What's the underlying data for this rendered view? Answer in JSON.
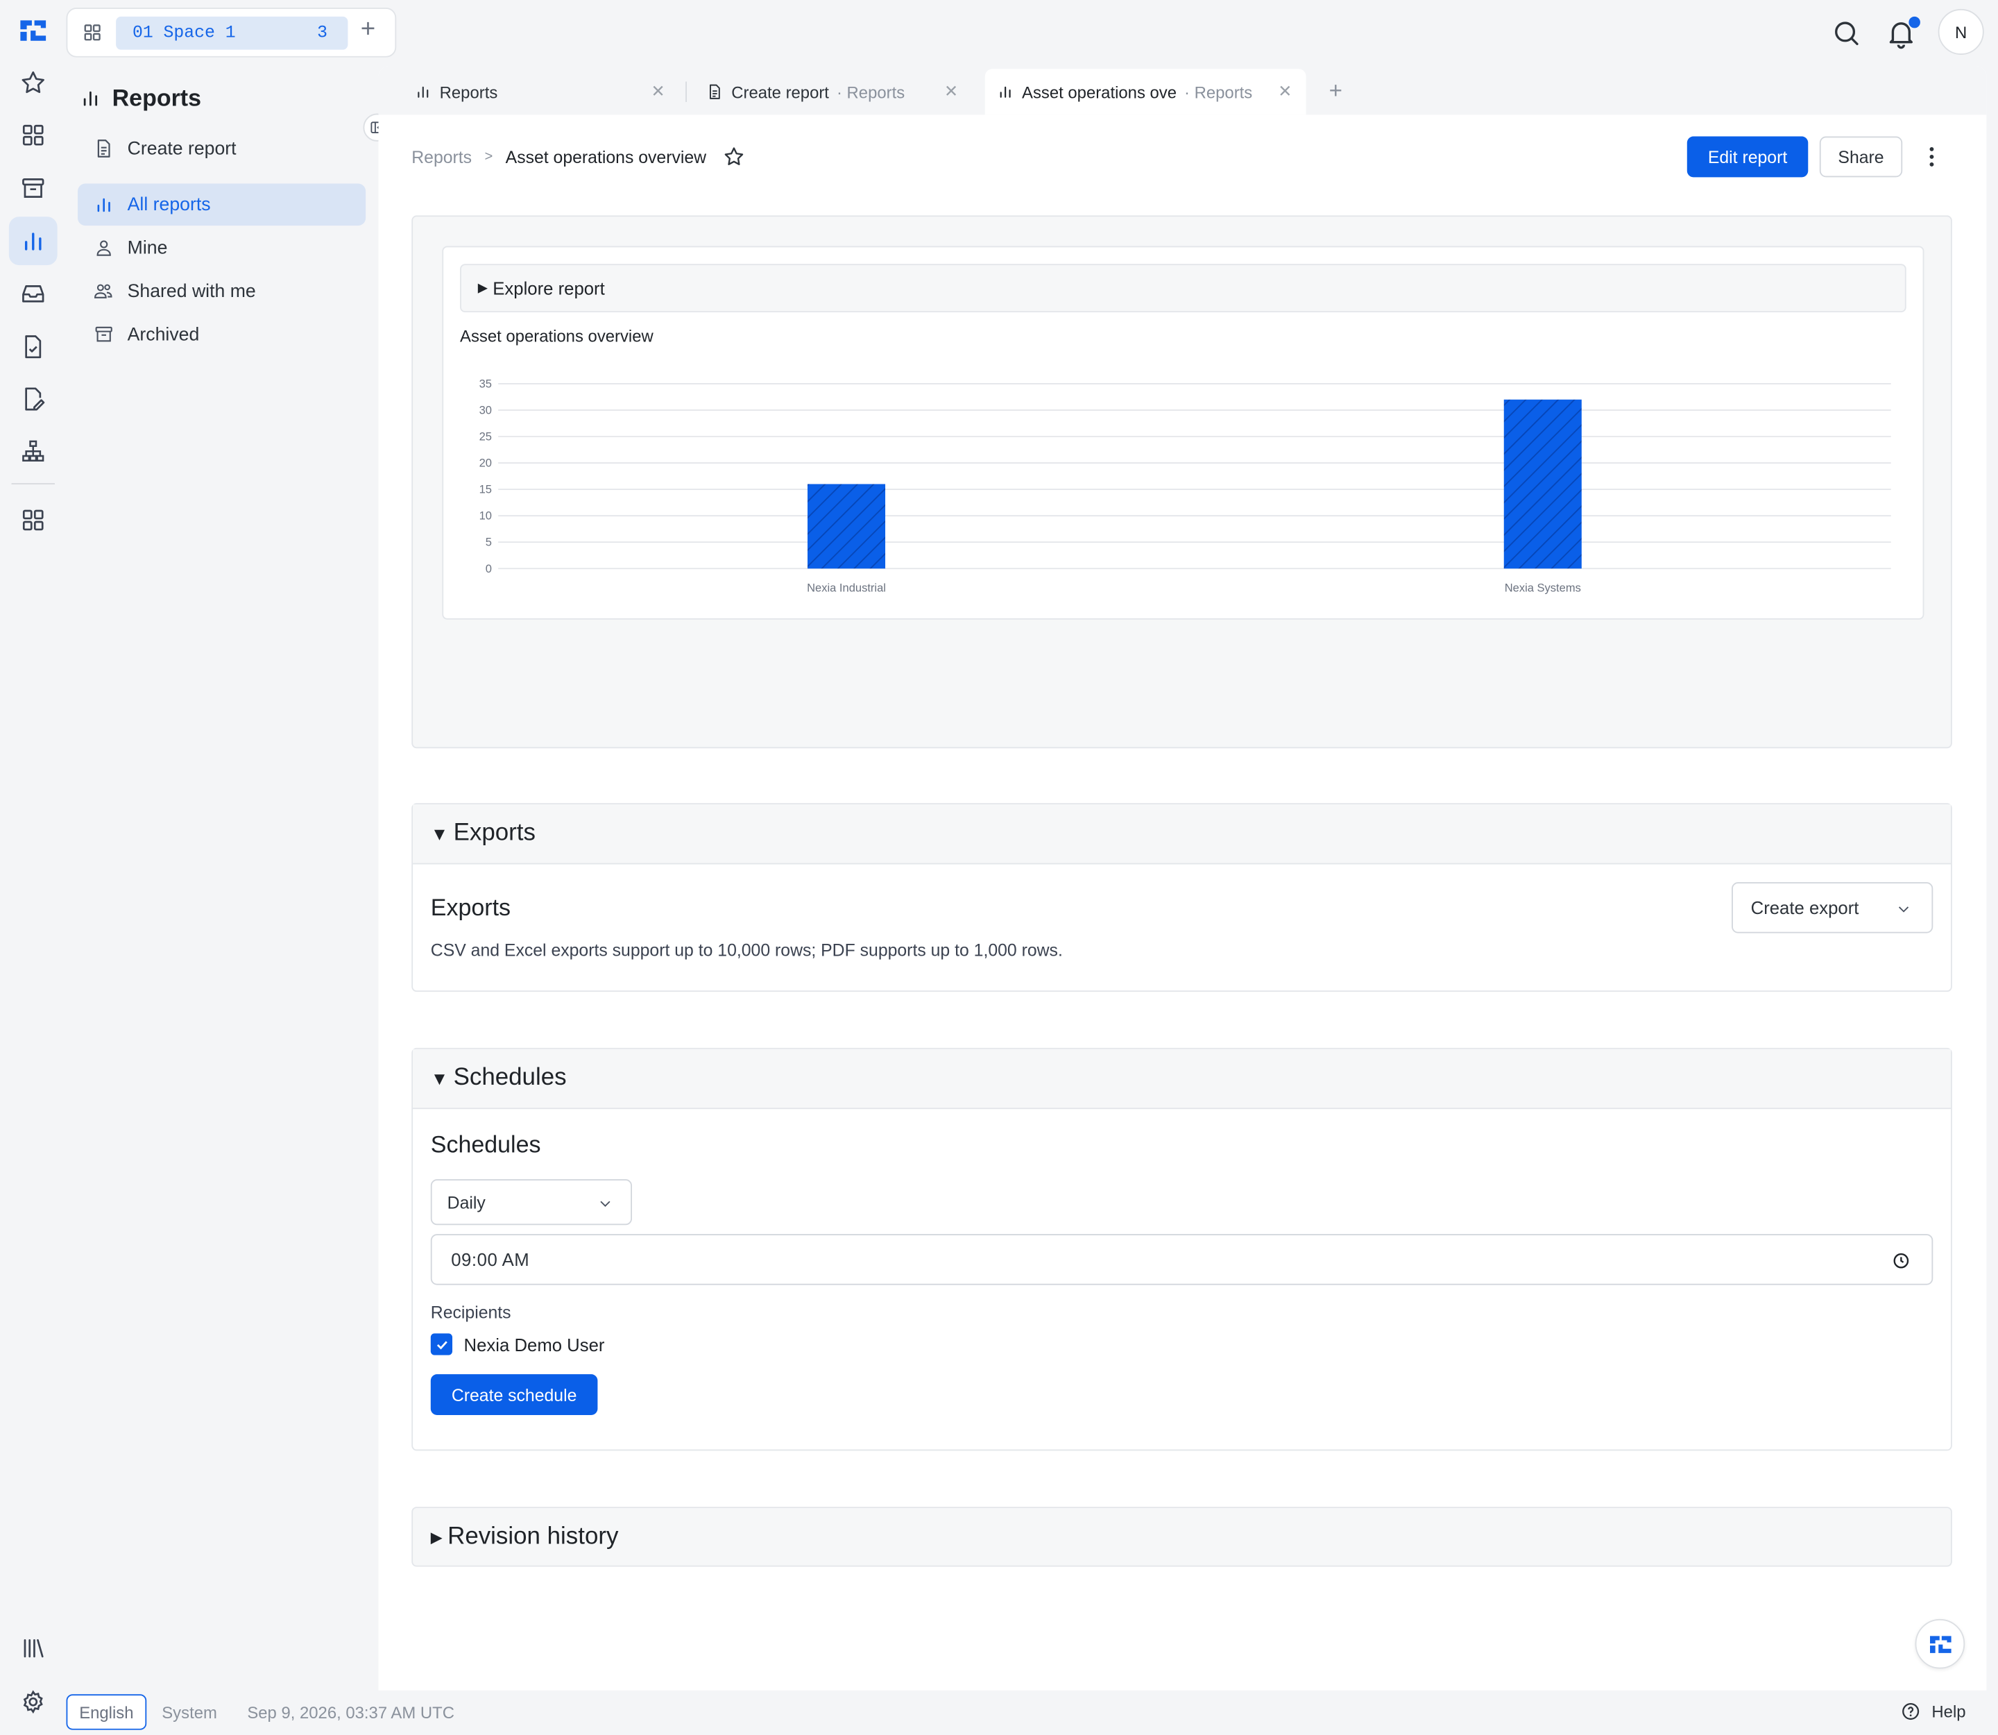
{
  "app": {
    "logo": "nexia-logo-icon"
  },
  "space": {
    "code": "01",
    "name": "Space 1",
    "count": "3",
    "add": "+"
  },
  "header": {
    "avatar": "N",
    "notification_dot_color": "#1565e8"
  },
  "rail": {
    "items": [
      "star-icon",
      "grid-icon",
      "archive-icon",
      "chart-icon",
      "inbox-icon",
      "file-check-icon",
      "file-edit-icon",
      "org-chart-icon",
      "apps-icon"
    ],
    "bottom": [
      "library-icon",
      "settings-icon"
    ]
  },
  "sidenav": {
    "title": "Reports",
    "create": "Create report",
    "items": [
      {
        "label": "All reports",
        "icon": "chart-icon",
        "active": true
      },
      {
        "label": "Mine",
        "icon": "user-icon"
      },
      {
        "label": "Shared with me",
        "icon": "users-icon"
      },
      {
        "label": "Archived",
        "icon": "archive-icon"
      }
    ]
  },
  "tabs": [
    {
      "label": "Reports",
      "sub": ""
    },
    {
      "label": "Create report",
      "sub": "· Reports"
    },
    {
      "label": "Asset operations ove",
      "sub": "· Reports",
      "active": true
    }
  ],
  "breadcrumb": {
    "parent": "Reports",
    "sep": ">",
    "current": "Asset operations overview"
  },
  "actions": {
    "edit": "Edit report",
    "share": "Share"
  },
  "report": {
    "explore": "Explore report",
    "chart_title": "Asset operations overview"
  },
  "chart_data": {
    "type": "bar",
    "title": "Asset operations overview",
    "categories": [
      "Nexia Industrial",
      "Nexia Systems"
    ],
    "values": [
      16,
      32
    ],
    "ylim": [
      0,
      35
    ],
    "yticks": [
      0,
      5,
      10,
      15,
      20,
      25,
      30,
      35
    ],
    "xlabel": "",
    "ylabel": "",
    "bar_color": "#0a5fe8",
    "grid": true
  },
  "exports": {
    "section": "Exports",
    "title": "Exports",
    "note": "CSV and Excel exports support up to 10,000 rows; PDF supports up to 1,000 rows.",
    "create": "Create export"
  },
  "schedules": {
    "section": "Schedules",
    "title": "Schedules",
    "frequency": "Daily",
    "time": "09:00 AM",
    "recipients_label": "Recipients",
    "recipient": "Nexia Demo User",
    "recipient_checked": true,
    "create": "Create schedule"
  },
  "revision": {
    "section": "Revision history"
  },
  "footer": {
    "language": "English",
    "theme": "System",
    "datetime": "Sep 9, 2026, 03:37 AM UTC",
    "help": "Help"
  }
}
